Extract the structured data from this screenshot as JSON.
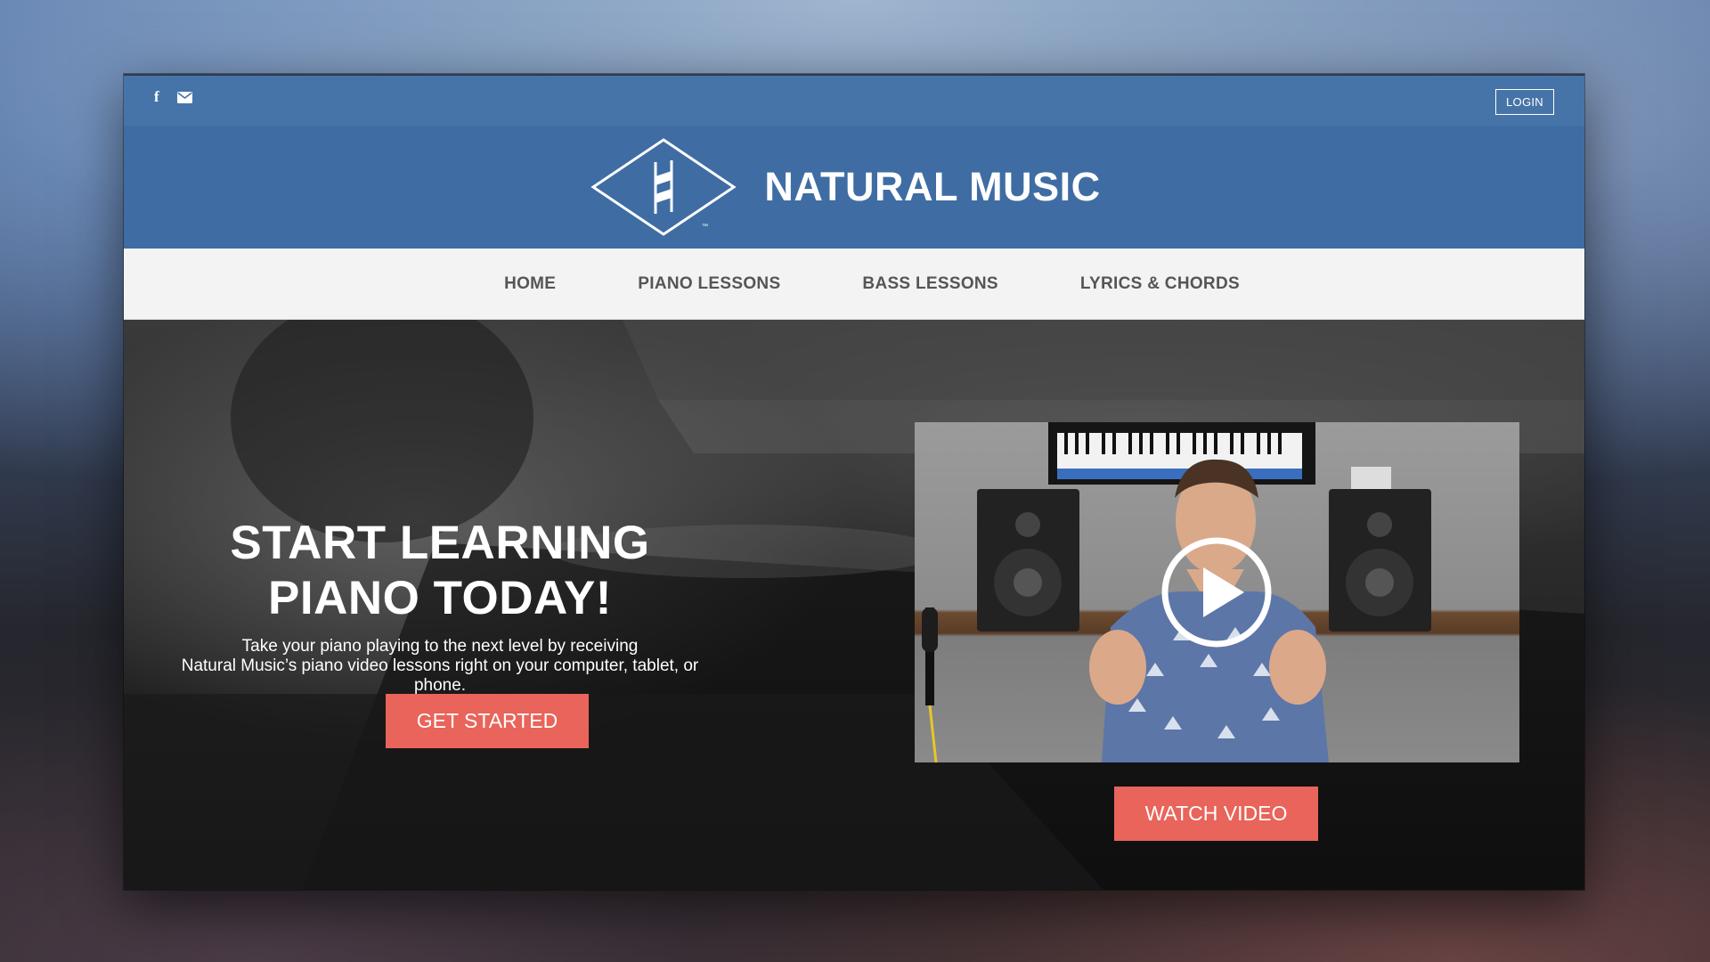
{
  "topbar": {
    "icons": [
      "facebook-icon",
      "envelope-icon"
    ],
    "login_label": "LOGIN"
  },
  "header": {
    "brand_name": "NATURAL MUSIC",
    "logo_icon": "natural-sign-diamond-logo",
    "logo_mark": "™"
  },
  "nav": {
    "items": [
      {
        "label": "HOME"
      },
      {
        "label": "PIANO LESSONS"
      },
      {
        "label": "BASS LESSONS"
      },
      {
        "label": "LYRICS & CHORDS"
      }
    ]
  },
  "hero": {
    "title_line1": "START LEARNING",
    "title_line2": "PIANO TODAY!",
    "description_line1": "Take your piano playing to the next level by receiving",
    "description_line2": "Natural Music’s piano video lessons right on your computer, tablet, or phone.",
    "cta_label": "GET STARTED",
    "video": {
      "play_icon": "play-circle-icon"
    },
    "watch_label": "WATCH VIDEO"
  },
  "colors": {
    "topbar": "#4774a8",
    "header": "#3f6da3",
    "nav_bg": "#f3f3f3",
    "nav_text": "#555555",
    "accent_button": "#e9645a"
  }
}
